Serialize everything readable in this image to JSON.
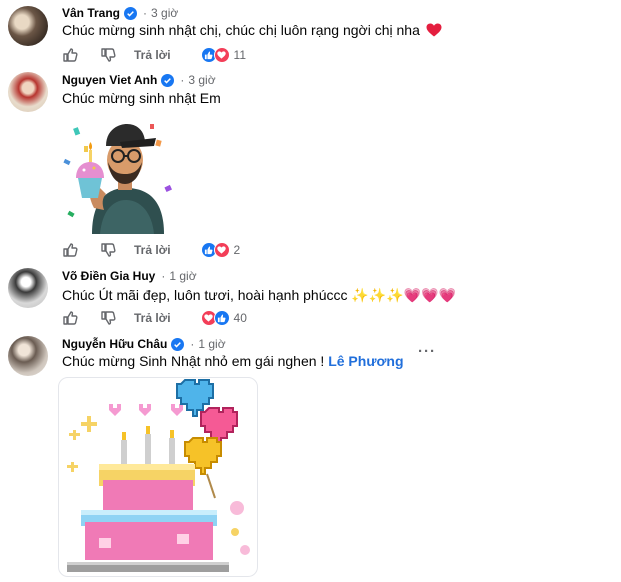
{
  "comments": [
    {
      "author": "Vân Trang",
      "time": "3 giờ",
      "text": "Chúc mừng sinh nhật chị, chúc chị luôn rạng ngời chị nha",
      "reply_label": "Trả lời",
      "reaction_count": "11",
      "reactions": [
        "like",
        "love"
      ]
    },
    {
      "author": "Nguyen Viet Anh",
      "time": "3 giờ",
      "text": "Chúc mừng sinh nhật Em",
      "reply_label": "Trả lời",
      "reaction_count": "2",
      "reactions": [
        "like",
        "love"
      ]
    },
    {
      "author": "Võ Điền Gia Huy",
      "time": "1 giờ",
      "text": "Chúc Út mãi đẹp, luôn tươi, hoài hạnh phúccc ✨✨✨💗💗💗",
      "reply_label": "Trả lời",
      "reaction_count": "40",
      "reactions": [
        "love",
        "like"
      ]
    },
    {
      "author": "Nguyễn Hữu Châu",
      "time": "1 giờ",
      "text": "Chúc mừng Sinh Nhật nhỏ em gái nghen !",
      "mention": "Lê Phương",
      "more_label": "···"
    }
  ],
  "colors": {
    "like_blue": "#1877f2",
    "love_red": "#f33e58",
    "verified_blue": "#1877f2",
    "secondary_text": "#65676b",
    "mention_blue": "#216fdb"
  }
}
